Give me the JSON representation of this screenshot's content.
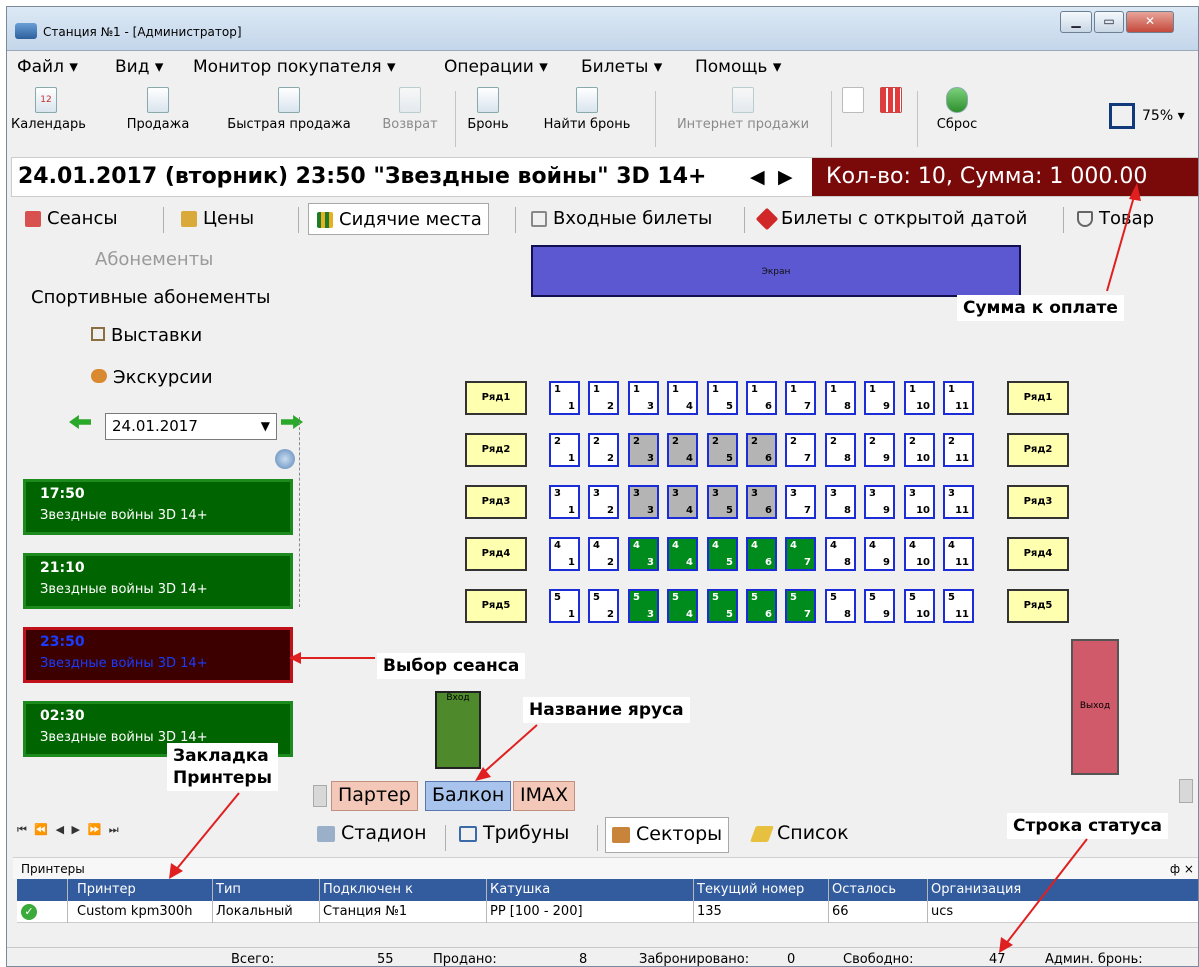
{
  "window": {
    "title": "Станция №1 - [Администратор]"
  },
  "menu": [
    "Файл ▾",
    "Вид ▾",
    "Монитор покупателя ▾",
    "Операции ▾",
    "Билеты ▾",
    "Помощь ▾"
  ],
  "toolbar": {
    "calendar": "Календарь",
    "calendar_day": "12",
    "sale": "Продажа",
    "quick_sale": "Быстрая продажа",
    "refund": "Возврат",
    "booking": "Бронь",
    "find_booking": "Найти бронь",
    "internet_sales": "Интернет продажи",
    "reset": "Сброс",
    "zoom": "75%"
  },
  "session_info": {
    "header": "24.01.2017  (вторник) 23:50  \"Звездные войны\" 3D 14+",
    "prev": "◀",
    "next": "▶",
    "summary": "Кол-во: 10, Сумма: 1 000.00"
  },
  "tabs": [
    "Сеансы",
    "Цены",
    "Сидячие места",
    "Входные билеты",
    "Билеты с открытой датой",
    "Товар"
  ],
  "left_panel": {
    "subscriptions": "Абонементы",
    "sport_subscriptions": "Спортивные абонементы",
    "exhibitions": "Выставки",
    "excursions": "Экскурсии",
    "date": "24.01.2017"
  },
  "sessions": [
    {
      "time": "17:50",
      "movie": "Звездные войны 3D 14+"
    },
    {
      "time": "21:10",
      "movie": "Звездные войны 3D 14+"
    },
    {
      "time": "23:50",
      "movie": "Звездные войны 3D 14+"
    },
    {
      "time": "02:30",
      "movie": "Звездные войны 3D 14+"
    }
  ],
  "hall": {
    "screen": "Экран",
    "entrance": "Вход",
    "exit": "Выход",
    "rows": [
      {
        "label": "Ряд1",
        "row": "1",
        "seats": [
          "1",
          "2",
          "3",
          "4",
          "5",
          "6",
          "7",
          "8",
          "9",
          "10",
          "11"
        ],
        "sold": [],
        "reserved": []
      },
      {
        "label": "Ряд2",
        "row": "2",
        "seats": [
          "1",
          "2",
          "3",
          "4",
          "5",
          "6",
          "7",
          "8",
          "9",
          "10",
          "11"
        ],
        "sold": [
          "3",
          "4",
          "5",
          "6"
        ],
        "reserved": []
      },
      {
        "label": "Ряд3",
        "row": "3",
        "seats": [
          "1",
          "2",
          "3",
          "4",
          "5",
          "6",
          "7",
          "8",
          "9",
          "10",
          "11"
        ],
        "sold": [
          "3",
          "4",
          "5",
          "6"
        ],
        "reserved": []
      },
      {
        "label": "Ряд4",
        "row": "4",
        "seats": [
          "1",
          "2",
          "3",
          "4",
          "5",
          "6",
          "7",
          "8",
          "9",
          "10",
          "11"
        ],
        "sold": [],
        "reserved": [
          "3",
          "4",
          "5",
          "6",
          "7"
        ]
      },
      {
        "label": "Ряд5",
        "row": "5",
        "seats": [
          "1",
          "2",
          "3",
          "4",
          "5",
          "6",
          "7",
          "8",
          "9",
          "10",
          "11"
        ],
        "sold": [],
        "reserved": [
          "3",
          "4",
          "5",
          "6",
          "7"
        ]
      }
    ],
    "tiers": [
      "Партер",
      "Балкон",
      "IMAX"
    ],
    "map_modes": [
      "Стадион",
      "Трибуны",
      "Секторы",
      "Список"
    ]
  },
  "printers": {
    "title": "Принтеры",
    "pin": "ф ×",
    "columns": [
      "Принтер",
      "Тип",
      "Подключен к",
      "Катушка",
      "Текущий номер",
      "Осталось",
      "Организация"
    ],
    "rows": [
      {
        "printer": "Custom kpm300h",
        "type": "Локальный",
        "connected": "Станция №1",
        "reel": "PP [100 - 200]",
        "current": "135",
        "left": "66",
        "org": "ucs"
      }
    ]
  },
  "status": {
    "total_label": "Всего:",
    "total": "55",
    "sold_label": "Продано:",
    "sold": "8",
    "reserved_label": "Забронировано:",
    "reserved": "0",
    "free_label": "Свободно:",
    "free": "47",
    "admin_label": "Админ. бронь:"
  },
  "annotations": {
    "sum": "Сумма к оплате",
    "session": "Выбор сеанса",
    "tier": "Название яруса",
    "printers_tab": "Закладка\nПринтеры",
    "status_line": "Строка статуса"
  },
  "colors": {
    "accent_summary": "#7a0a0a",
    "reserved_seat": "#008c1c",
    "sold_seat": "#b4b4b4",
    "screen": "#5b58d1",
    "session": "#006400",
    "session_selected": "#3d0000"
  }
}
